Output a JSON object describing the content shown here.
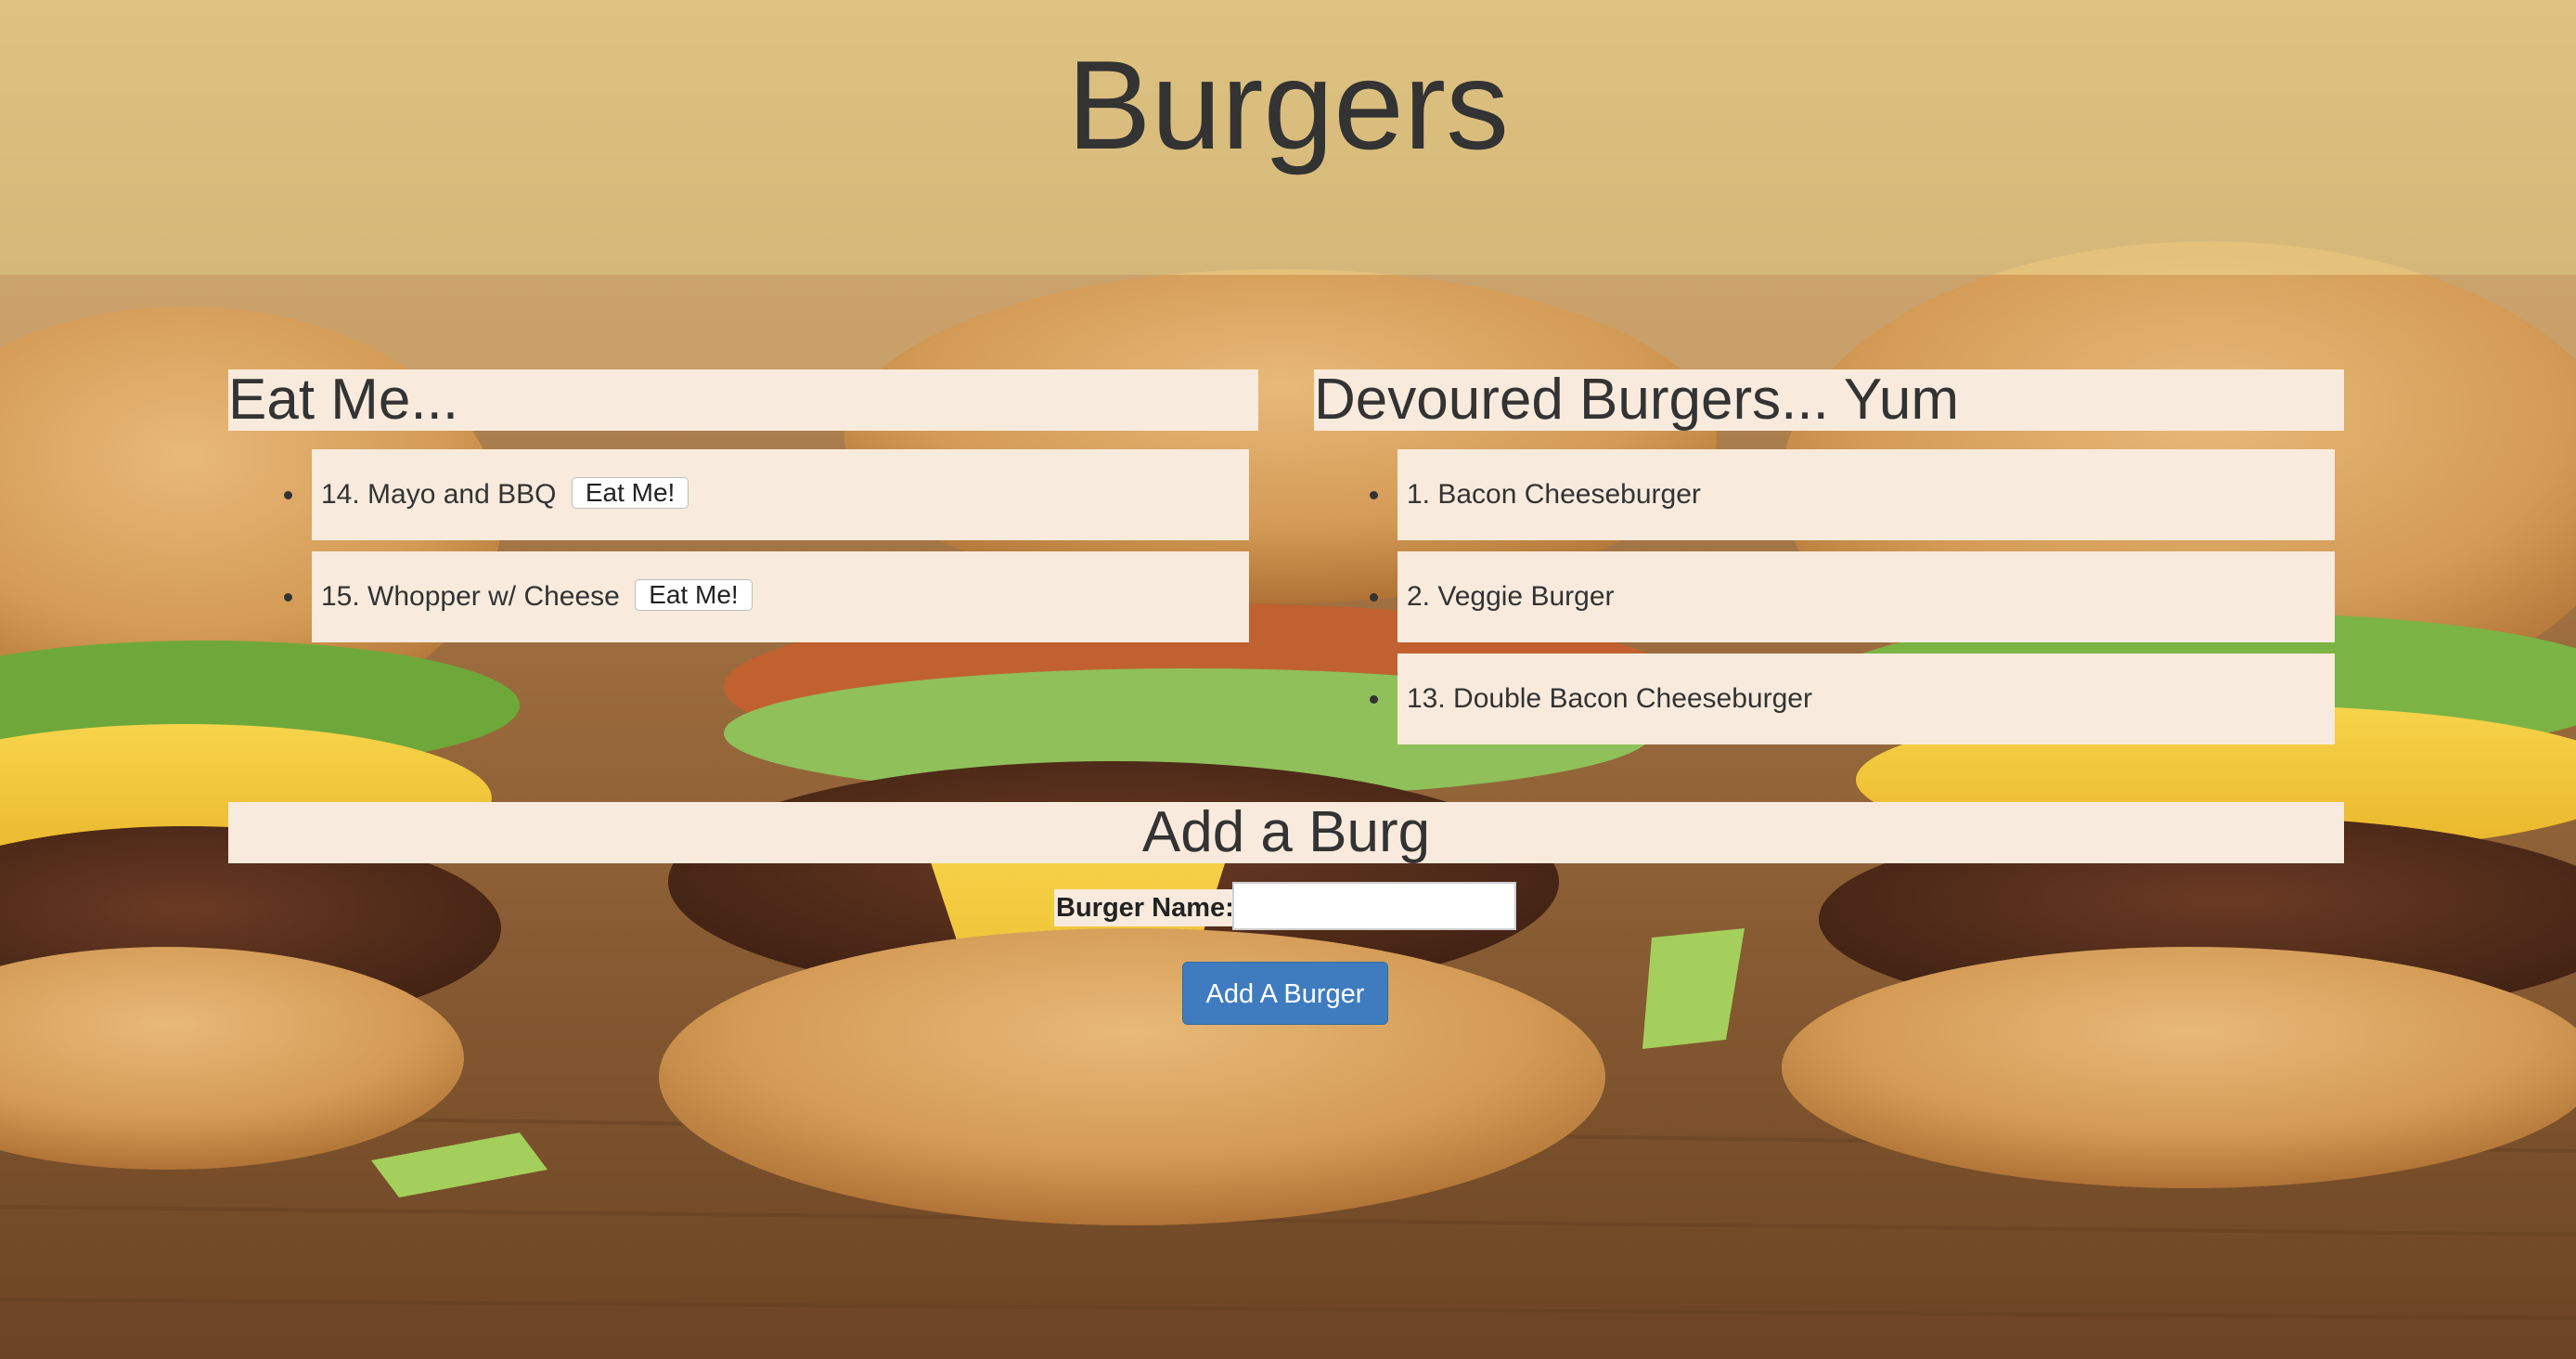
{
  "header": {
    "title": "Burgers"
  },
  "uneaten": {
    "heading": "Eat Me...",
    "items": [
      {
        "label": "14. Mayo and BBQ",
        "button_label": "Eat Me!"
      },
      {
        "label": "15. Whopper w/ Cheese",
        "button_label": "Eat Me!"
      }
    ]
  },
  "devoured": {
    "heading": "Devoured Burgers... Yum",
    "items": [
      {
        "label": "1. Bacon Cheeseburger"
      },
      {
        "label": "2. Veggie Burger"
      },
      {
        "label": "13. Double Bacon Cheeseburger"
      }
    ]
  },
  "add_form": {
    "heading": "Add a Burg",
    "name_label": "Burger Name:",
    "name_value": "",
    "name_placeholder": "",
    "submit_label": "Add A Burger"
  },
  "colors": {
    "panel_background": "#f8ebdd",
    "text": "#333333",
    "submit_button": "#3f7cbf",
    "header_tint": "#eede96"
  }
}
